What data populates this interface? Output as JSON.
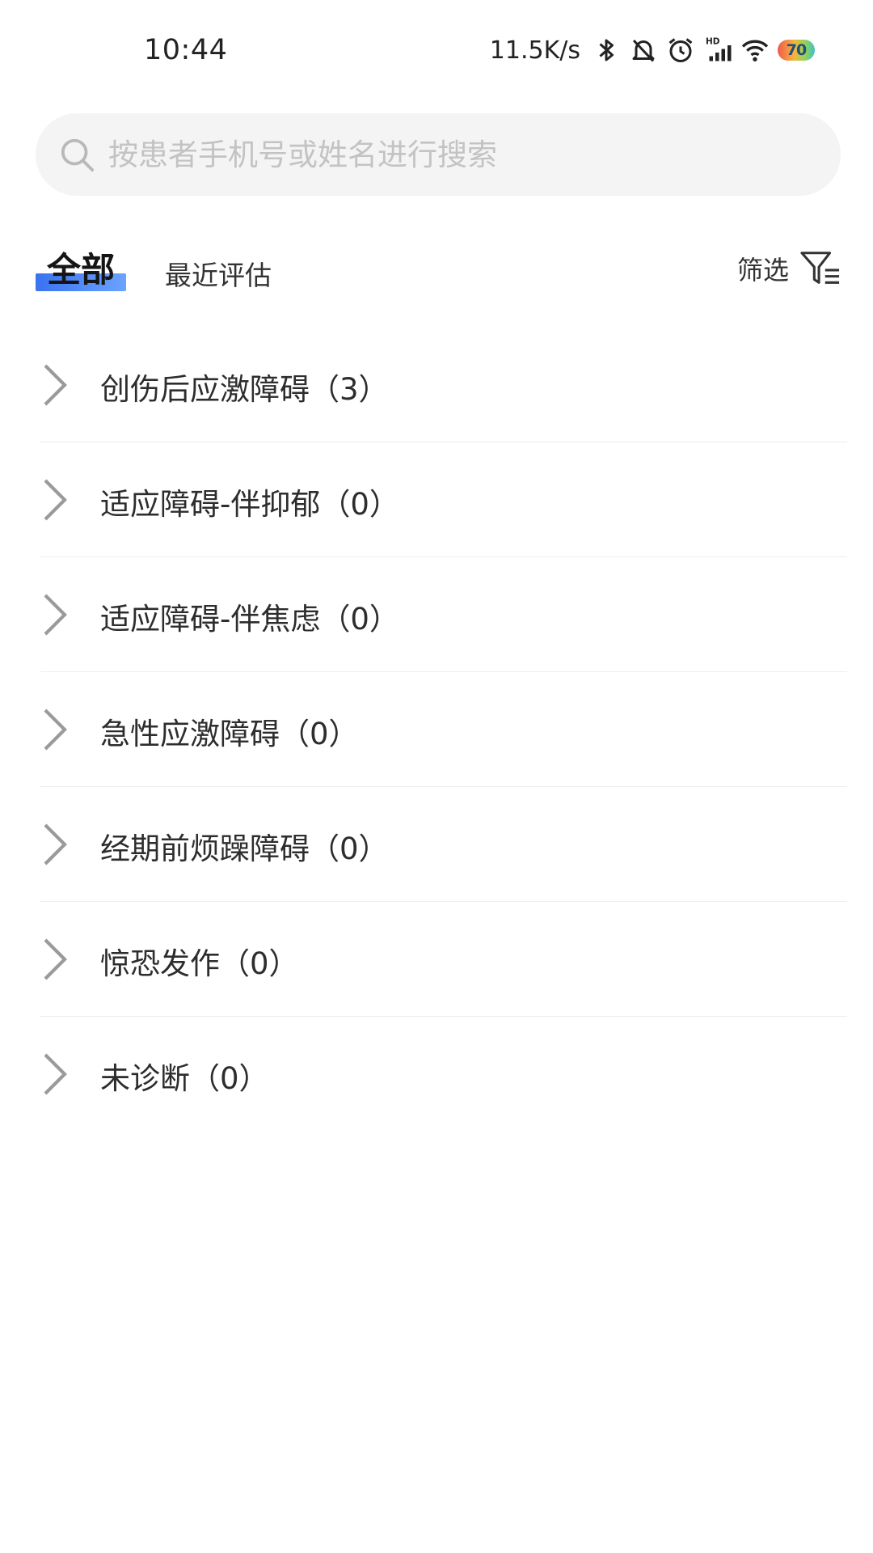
{
  "status_bar": {
    "time": "10:44",
    "net_speed": "11.5K/s",
    "battery_level": "70",
    "icons": [
      "bluetooth-icon",
      "silent-bell-icon",
      "alarm-icon",
      "hd-signal-icon",
      "wifi-icon",
      "battery-icon"
    ]
  },
  "search": {
    "placeholder": "按患者手机号或姓名进行搜索",
    "icon": "search-icon"
  },
  "tabs": {
    "all_label": "全部",
    "recent_label": "最近评估",
    "active": "全部",
    "accent_color": "#3a72f0"
  },
  "filter": {
    "label": "筛选",
    "icon": "filter-icon"
  },
  "categories": [
    {
      "label": "创伤后应激障碍（3）"
    },
    {
      "label": "适应障碍-伴抑郁（0）"
    },
    {
      "label": "适应障碍-伴焦虑（0）"
    },
    {
      "label": "急性应激障碍（0）"
    },
    {
      "label": "经期前烦躁障碍（0）"
    },
    {
      "label": "惊恐发作（0）"
    },
    {
      "label": "未诊断（0）"
    }
  ]
}
